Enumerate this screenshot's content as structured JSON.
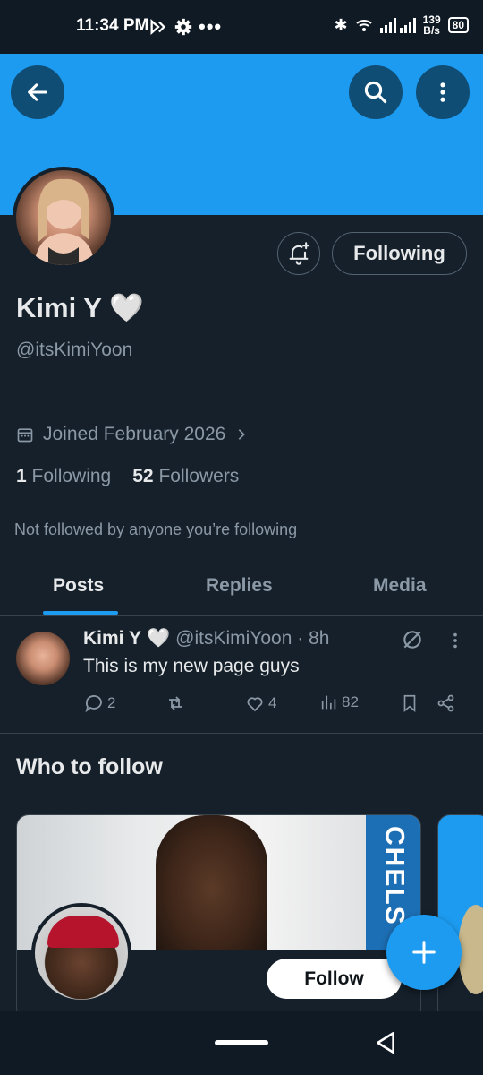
{
  "status_bar": {
    "time": "11:34 PM",
    "speed_value": "139",
    "speed_unit": "B/s",
    "battery": "80"
  },
  "colors": {
    "accent": "#1d9bf0",
    "background": "#15202b",
    "muted_text": "#8b98a5"
  },
  "header": {
    "back_icon": "arrow-left-icon",
    "search_icon": "search-icon",
    "more_icon": "more-vertical-icon"
  },
  "profile": {
    "display_name": "Kimi Y",
    "name_badge": "🤍",
    "handle": "@itsKimiYoon",
    "joined": "Joined February 2026",
    "following_count": "1",
    "following_label": "Following",
    "followers_count": "52",
    "followers_label": "Followers",
    "mutuals_note": "Not followed by anyone you’re following",
    "follow_state_button": "Following"
  },
  "tabs": [
    {
      "label": "Posts",
      "active": true
    },
    {
      "label": "Replies",
      "active": false
    },
    {
      "label": "Media",
      "active": false
    }
  ],
  "post": {
    "author_name": "Kimi Y",
    "author_badge": "🤍",
    "handle_time": "@itsKimiYoon · 8h",
    "text": "This is my new page guys",
    "reply_count": "2",
    "repost_count": "",
    "like_count": "4",
    "view_count": "82"
  },
  "who_to_follow": {
    "title": "Who to follow",
    "card_banner_text": "CHELS",
    "follow_button": "Follow"
  }
}
